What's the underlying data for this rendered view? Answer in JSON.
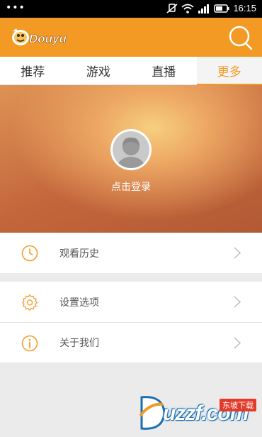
{
  "status_bar": {
    "dots": "•••",
    "time": "16:15",
    "icons": [
      "mute-icon",
      "wifi-icon",
      "signal-icon",
      "battery-icon"
    ]
  },
  "app_bar": {
    "logo_text": "DOUYU",
    "search_icon": "search-icon",
    "accent": "#f39a24"
  },
  "tabs": [
    {
      "label": "推荐",
      "active": false
    },
    {
      "label": "游戏",
      "active": false
    },
    {
      "label": "直播",
      "active": false
    },
    {
      "label": "更多",
      "active": true
    }
  ],
  "profile": {
    "avatar_icon": "default-avatar-icon",
    "login_label": "点击登录"
  },
  "menu": {
    "history": {
      "label": "观看历史",
      "icon": "clock-icon"
    },
    "settings": {
      "label": "设置选项",
      "icon": "gear-icon"
    },
    "about": {
      "label": "关于我们",
      "icon": "info-icon"
    }
  },
  "watermark": {
    "text": "uzzf.com",
    "badge": "东坡下载"
  }
}
